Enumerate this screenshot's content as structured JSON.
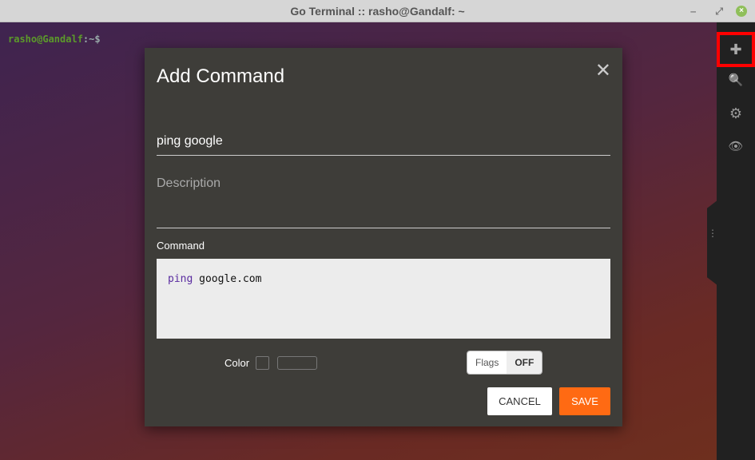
{
  "window": {
    "title": "Go Terminal :: rasho@Gandalf: ~",
    "minimize": "‒",
    "maximize": "⤢",
    "close": "×"
  },
  "terminal": {
    "user": "rasho@Gandalf",
    "path": ":~$"
  },
  "sidebar": {
    "items": [
      {
        "name": "add",
        "icon": "plus-icon",
        "glyph": "✚"
      },
      {
        "name": "search",
        "icon": "search-icon",
        "glyph": "🔍"
      },
      {
        "name": "settings",
        "icon": "gear-icon",
        "glyph": "⚙"
      },
      {
        "name": "view",
        "icon": "eye-icon",
        "glyph": "👁"
      }
    ],
    "handle": "⋮",
    "highlight_color": "#ff0000"
  },
  "dialog": {
    "title": "Add Command",
    "close": "✕",
    "name_value": "ping google",
    "description_placeholder": "Description",
    "command_label": "Command",
    "command_keyword": "ping",
    "command_args": " google.com",
    "color_label": "Color",
    "flags_label": "Flags",
    "flags_state": "OFF",
    "cancel": "CANCEL",
    "save": "SAVE",
    "save_color": "#ff6a13"
  }
}
